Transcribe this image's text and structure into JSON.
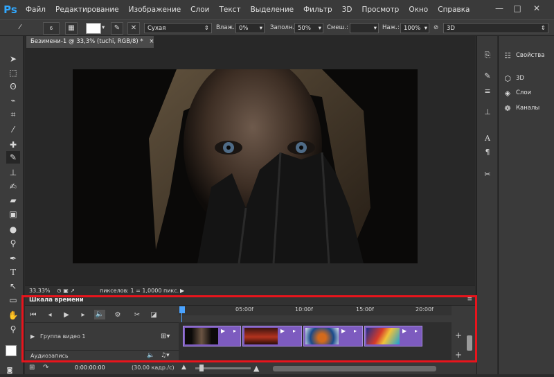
{
  "app": {
    "logo": "Ps",
    "brand_color": "#31a8ff"
  },
  "menu": [
    "Файл",
    "Редактирование",
    "Изображение",
    "Слои",
    "Текст",
    "Выделение",
    "Фильтр",
    "3D",
    "Просмотр",
    "Окно",
    "Справка"
  ],
  "window_controls": {
    "minimize": "—",
    "maximize": "□",
    "close": "✕"
  },
  "options_bar": {
    "brush_size": "6",
    "brush_preset": "Сухая",
    "wet_label": "Влаж.:",
    "wet_value": "0%",
    "load_label": "Заполн.:",
    "load_value": "50%",
    "mix_label": "Смеш.:",
    "mix_value": "",
    "flow_label": "Наж.:",
    "flow_value": "100%",
    "mode_value": "3D"
  },
  "document": {
    "tab_title": "Безимени-1 @ 33,3% (tuchi, RGB/8) *",
    "tab_close": "×"
  },
  "status_bar": {
    "zoom": "33,33%",
    "info": "пикселов: 1 = 1,0000 пикс."
  },
  "right_panel": {
    "items": [
      {
        "icon": "properties-icon",
        "label": "Свойства"
      },
      {
        "icon": "cube-3d-icon",
        "label": "3D"
      },
      {
        "icon": "layers-icon",
        "label": "Слои"
      },
      {
        "icon": "channels-icon",
        "label": "Каналы"
      }
    ]
  },
  "timeline": {
    "title": "Шкала времени",
    "ruler": [
      "05:00f",
      "10:00f",
      "15:00f",
      "20:00f"
    ],
    "video_group": "Группа видео 1",
    "audio_track": "Аудиозапись",
    "timecode": "0:00:00:00",
    "fps": "(30.00 кадр./с)",
    "add": "+",
    "clip_color": "#7d5bbf",
    "clips": [
      {
        "thumb": "face-thumbnail"
      },
      {
        "thumb": "red-sky-thumbnail"
      },
      {
        "thumb": "car-thumbnail"
      },
      {
        "thumb": "colorful-abstract-thumbnail"
      }
    ]
  },
  "highlight_color": "#e8141c"
}
